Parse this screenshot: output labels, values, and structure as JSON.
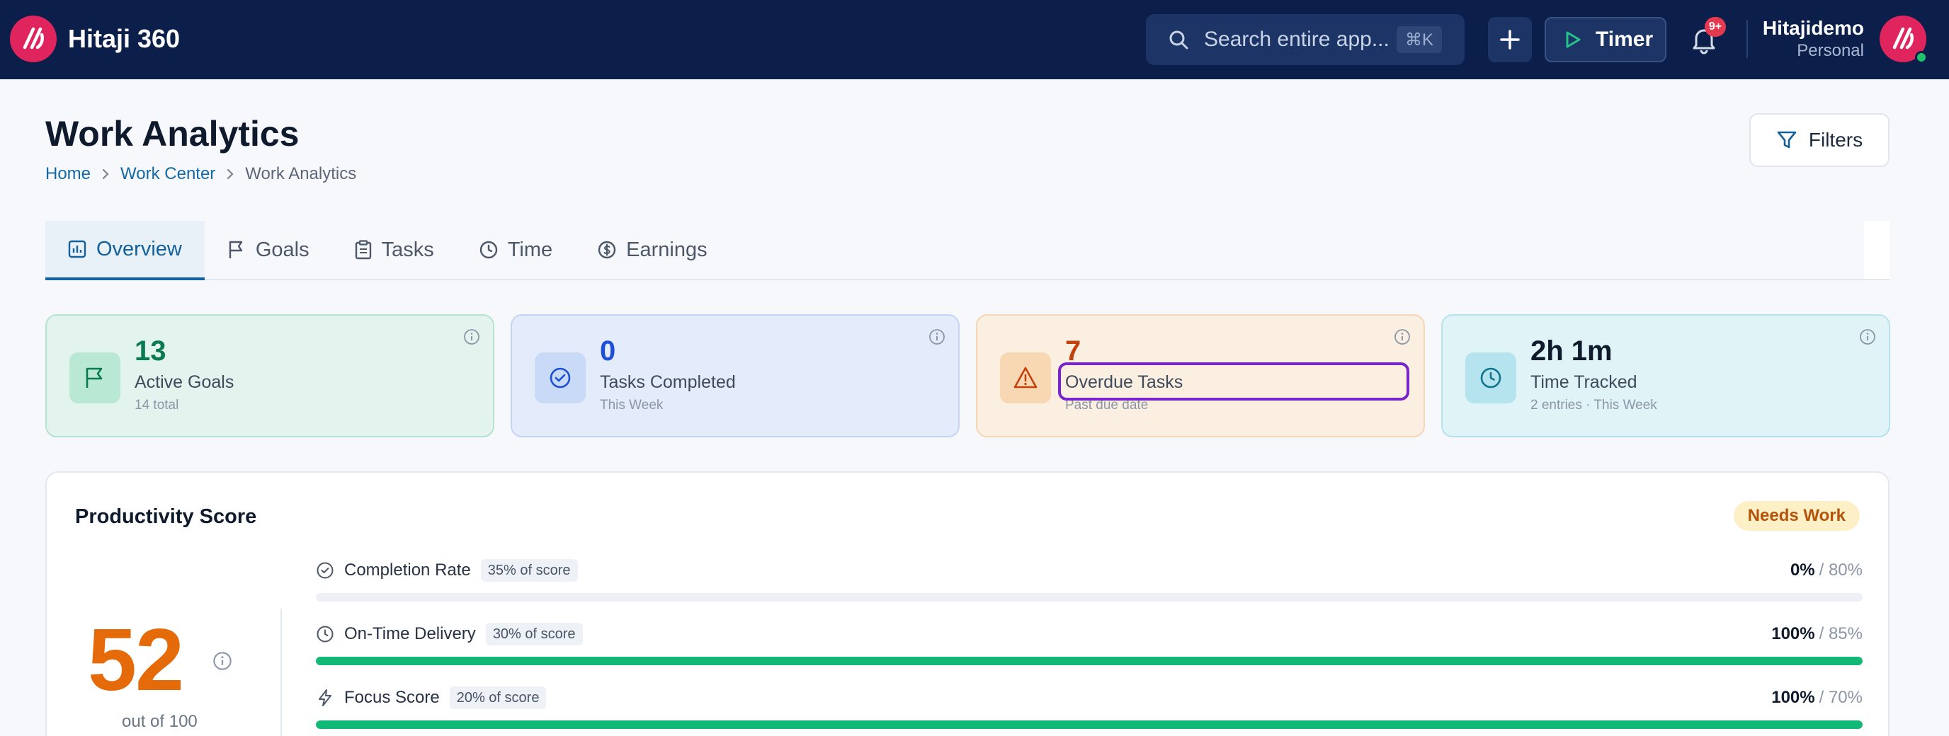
{
  "app": {
    "name": "Hitaji 360",
    "search_placeholder": "Search entire app...",
    "search_shortcut": "⌘K",
    "timer_label": "Timer",
    "notification_badge": "9+",
    "user_name": "Hitajidemo",
    "user_role": "Personal"
  },
  "page": {
    "title": "Work Analytics",
    "breadcrumb": [
      "Home",
      "Work Center",
      "Work Analytics"
    ],
    "filters_label": "Filters"
  },
  "tabs": [
    {
      "label": "Overview",
      "icon": "bar-chart-icon",
      "active": true
    },
    {
      "label": "Goals",
      "icon": "flag-icon",
      "active": false
    },
    {
      "label": "Tasks",
      "icon": "clipboard-icon",
      "active": false
    },
    {
      "label": "Time",
      "icon": "clock-icon",
      "active": false
    },
    {
      "label": "Earnings",
      "icon": "dollar-icon",
      "active": false
    }
  ],
  "stats": [
    {
      "value": "13",
      "label": "Active Goals",
      "sub": "14 total",
      "icon": "flag-icon",
      "accent": "#0a7a52"
    },
    {
      "value": "0",
      "label": "Tasks Completed",
      "sub": "This Week",
      "icon": "check-circle-icon",
      "accent": "#1d4fd8"
    },
    {
      "value": "7",
      "label": "Overdue Tasks",
      "sub": "Past due date",
      "icon": "alert-triangle-icon",
      "accent": "#c2410c"
    },
    {
      "value": "2h 1m",
      "label": "Time Tracked",
      "sub": "2 entries · This Week",
      "icon": "clock-icon",
      "accent": "#0e7490"
    }
  ],
  "productivity": {
    "title": "Productivity Score",
    "status": "Needs Work",
    "score": "52",
    "score_sub": "out of 100",
    "metrics": [
      {
        "name": "Completion Rate",
        "weight": "35% of score",
        "value": "0%",
        "target": "/ 80%",
        "progress": 0.0,
        "icon": "check-circle-icon"
      },
      {
        "name": "On-Time Delivery",
        "weight": "30% of score",
        "value": "100%",
        "target": "/ 85%",
        "progress": 1.0,
        "icon": "clock-icon"
      },
      {
        "name": "Focus Score",
        "weight": "20% of score",
        "value": "100%",
        "target": "/ 70%",
        "progress": 1.0,
        "icon": "lightning-icon"
      }
    ]
  },
  "colors": {
    "nav_bg": "#0b1f4a",
    "brand": "#e0245e",
    "primary": "#13609c",
    "success": "#12b876",
    "score": "#e56b0a",
    "highlight": "#7a25c9"
  }
}
